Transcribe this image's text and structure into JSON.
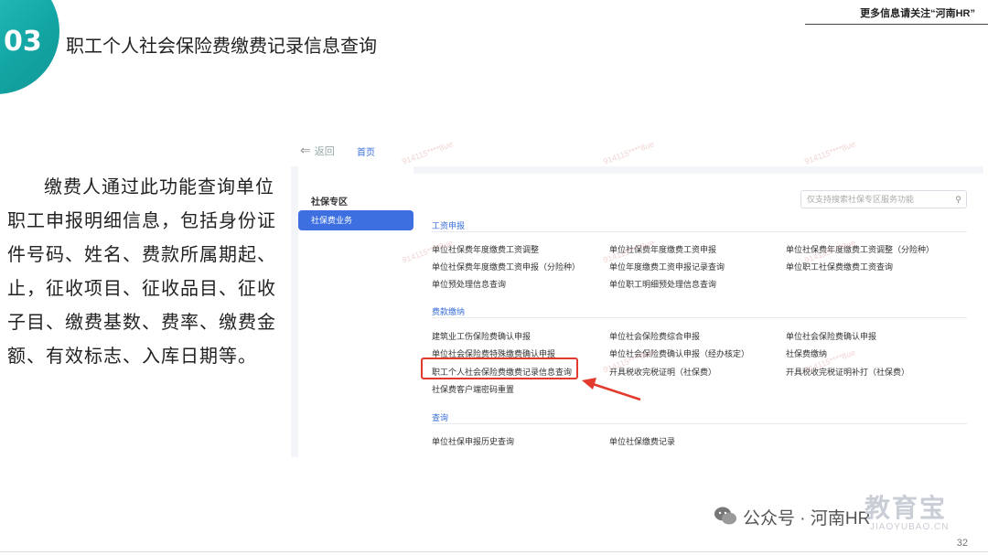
{
  "slide": {
    "number": "03",
    "title": "职工个人社会保险费缴费记录信息查询",
    "top_note": "更多信息请关注“河南HR”",
    "description": "缴费人通过此功能查询单位职工申报明细信息，包括身份证件号码、姓名、费款所属期起、止，征收项目、征收品目、征收子目、缴费基数、费率、缴费金额、有效标志、入库日期等。",
    "page_number": "32"
  },
  "screenshot": {
    "back_label": "返回",
    "home_label": "首页",
    "sidebar": {
      "title": "社保专区",
      "active_item": "社保费业务"
    },
    "search_placeholder": "仅支持搜索社保专区服务功能",
    "sections": [
      {
        "title": "工资申报",
        "items": [
          "单位社保费年度缴费工资调整",
          "单位社保费年度缴费工资申报",
          "单位社保费年度缴费工资调整（分险种）",
          "单位社保费年度缴费工资申报（分险种）",
          "单位年度缴费工资申报记录查询",
          "单位职工社保费缴费工资查询",
          "单位预处理信息查询",
          "单位职工明细预处理信息查询"
        ]
      },
      {
        "title": "费款缴纳",
        "items": [
          "建筑业工伤保险费确认申报",
          "单位社会保险费综合申报",
          "单位社会保险费确认申报",
          "单位社会保险费特殊缴费确认申报",
          "单位社会保险费确认申报（经办核定）",
          "社保费缴纳",
          "职工个人社会保险费缴费记录信息查询",
          "开具税收完税证明（社保费）",
          "开具税收完税证明补打（社保费）",
          "社保费客户端密码重置"
        ]
      },
      {
        "title": "查询",
        "items": [
          "单位社保申报历史查询",
          "单位社保缴费记录"
        ]
      }
    ]
  },
  "footer": {
    "brand": "公众号 · 河南HR",
    "logo_text": "教育宝",
    "logo_sub": "JIAOYUBAO.CN"
  },
  "colors": {
    "accent": "#14a7a5",
    "link": "#3b6fd9",
    "highlight": "#e23b2e"
  }
}
